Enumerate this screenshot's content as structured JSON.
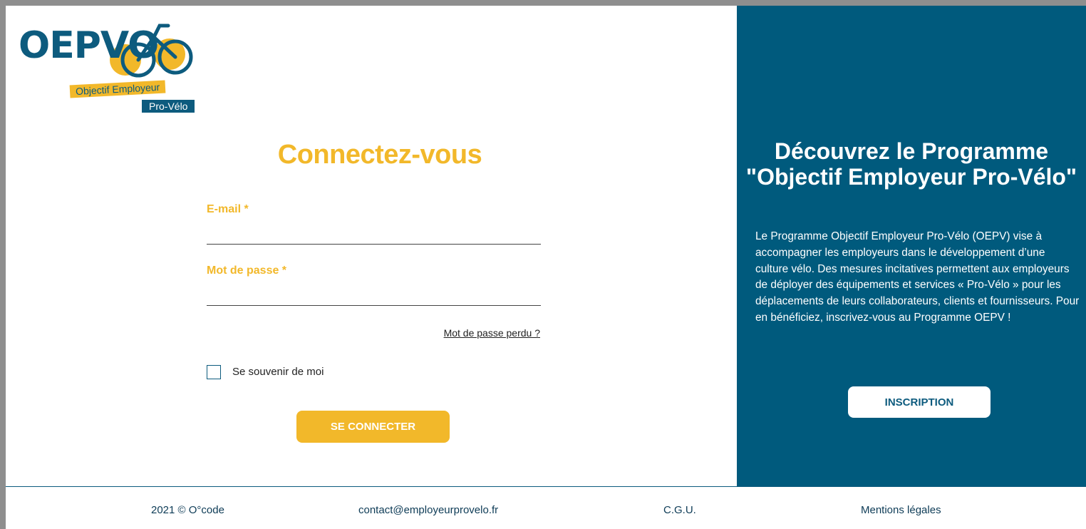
{
  "brand": {
    "logo_text": "OEPVO",
    "tagline_1": "Objectif Employeur",
    "tagline_2": "Pro-Vélo",
    "primary_color": "#0d5b7e",
    "accent_color": "#f2b82a"
  },
  "login": {
    "title": "Connectez-vous",
    "email_label": "E-mail *",
    "email_value": "",
    "password_label": "Mot de passe *",
    "password_value": "",
    "forgot_password": "Mot de passe perdu ?",
    "remember_me": "Se souvenir de moi",
    "remember_checked": false,
    "submit_label": "SE CONNECTER"
  },
  "promo": {
    "title": "Découvrez le Programme \"Objectif Employeur Pro-Vélo\"",
    "description": "Le Programme Objectif Employeur Pro-Vélo (OEPV) vise à accompagner les employeurs dans le développement d’une culture vélo. Des mesures incitatives permettent aux employeurs de déployer des équipements et services « Pro-Vélo » pour les déplacements de leurs collaborateurs, clients et fournisseurs. Pour en bénéficiez, inscrivez-vous au Programme OEPV !",
    "signup_label": "INSCRIPTION",
    "background_color": "#005a7d"
  },
  "footer": {
    "copyright": "2021 © O°code",
    "contact_email": "contact@employeurprovelo.fr",
    "cgu": "C.G.U.",
    "legal": "Mentions légales"
  }
}
